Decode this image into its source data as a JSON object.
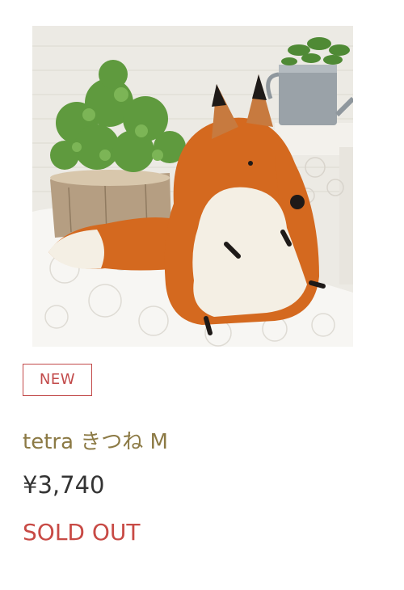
{
  "product": {
    "image_alt": "tetra きつね M",
    "badge": "NEW",
    "title": "tetra きつね M",
    "price": "¥3,740",
    "status": "SOLD OUT"
  },
  "colors": {
    "badge": "#c24a4a",
    "title": "#8c7a45",
    "price": "#333333",
    "sold_out": "#c84a45",
    "fox_fur": "#d4691f",
    "fox_belly": "#f4efe4"
  }
}
